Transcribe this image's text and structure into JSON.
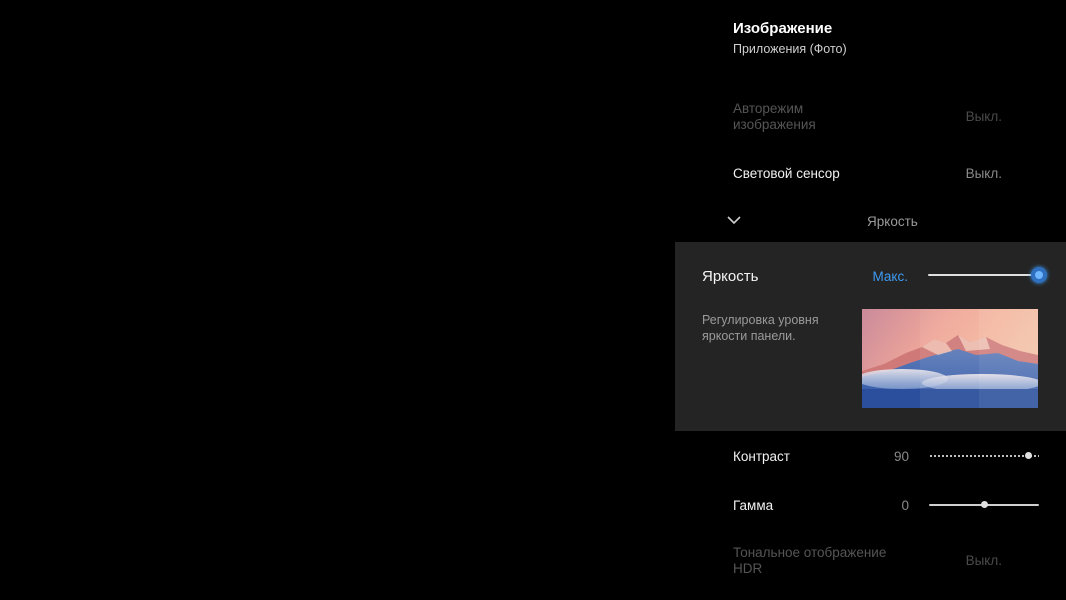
{
  "header": {
    "title": "Изображение",
    "subtitle": "Приложения (Фото)"
  },
  "rows": {
    "auto_mode": {
      "label_line1": "Авторежим",
      "label_line2": "изображения",
      "value": "Выкл."
    },
    "light_sensor": {
      "label": "Световой сенсор",
      "value": "Выкл."
    },
    "brightness_collapse": {
      "label": "Яркость",
      "icon": "chevron-down-icon"
    },
    "contrast": {
      "label": "Контраст",
      "value": "90",
      "level_fraction": 0.9
    },
    "gamma": {
      "label": "Гамма",
      "value": "0",
      "level_fraction": 0.5
    },
    "hdr": {
      "label_line1": "Тональное отображение",
      "label_line2": "HDR",
      "value": "Выкл."
    }
  },
  "brightness_card": {
    "title": "Яркость",
    "value": "Макс.",
    "level_fraction": 1.0,
    "description": "Регулировка уровня яркости панели.",
    "accent_color": "#3d9af2"
  }
}
